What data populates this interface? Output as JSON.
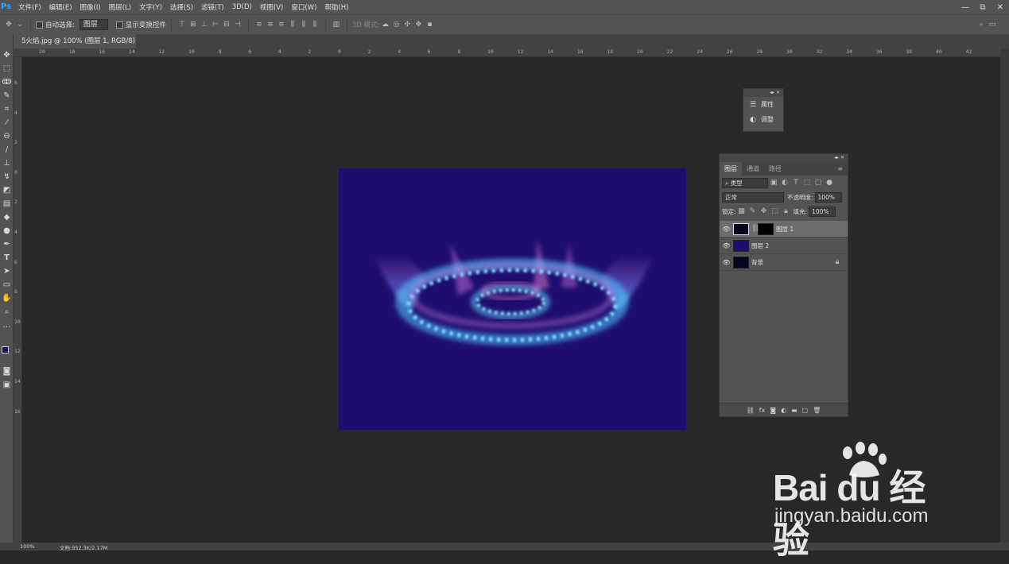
{
  "app": {
    "logo": "Ps"
  },
  "menu": [
    "文件(F)",
    "编辑(E)",
    "图像(I)",
    "图层(L)",
    "文字(Y)",
    "选择(S)",
    "滤镜(T)",
    "3D(D)",
    "视图(V)",
    "窗口(W)",
    "帮助(H)"
  ],
  "window_controls": [
    "—",
    "⧉",
    "✕"
  ],
  "options": {
    "auto_select_label": "自动选择:",
    "auto_select_value": "图层",
    "show_transform_label": "显示变换控件",
    "mode_3d_label": "3D 模式:"
  },
  "document_tab": {
    "title": "5火焰.jpg @ 100% (图层 1, RGB/8) *",
    "close": "×"
  },
  "ruler_h": [
    "20",
    "18",
    "16",
    "14",
    "12",
    "10",
    "8",
    "6",
    "4",
    "2",
    "0",
    "2",
    "4",
    "6",
    "8",
    "10",
    "12",
    "14",
    "16",
    "18",
    "20",
    "22",
    "24",
    "26",
    "28",
    "30",
    "32",
    "34",
    "36",
    "38",
    "40",
    "42"
  ],
  "ruler_v": [
    "6",
    "4",
    "2",
    "0",
    "2",
    "4",
    "6",
    "8",
    "10",
    "12",
    "14",
    "16"
  ],
  "mini_panel": {
    "items": [
      "属性",
      "调整"
    ]
  },
  "layers_panel": {
    "tabs": [
      "图层",
      "通道",
      "路径"
    ],
    "filter_value": "类型",
    "blend_mode": "正常",
    "opacity_label": "不透明度:",
    "opacity_value": "100%",
    "lock_label": "锁定:",
    "fill_label": "填充:",
    "fill_value": "100%",
    "layers": [
      {
        "name": "图层 1",
        "selected": true
      },
      {
        "name": "图层 2",
        "selected": false
      },
      {
        "name": "背景",
        "selected": false
      }
    ]
  },
  "status": {
    "zoom": "100%",
    "doc_info": "文档:952.3K/2.17M"
  },
  "watermark": {
    "logo": "Bai du 经验",
    "url": "jingyan.baidu.com"
  },
  "colors": {
    "canvas_bg": "#1e0d6e",
    "panel": "#535353",
    "work": "#282828",
    "accent": "#31a8ff"
  }
}
